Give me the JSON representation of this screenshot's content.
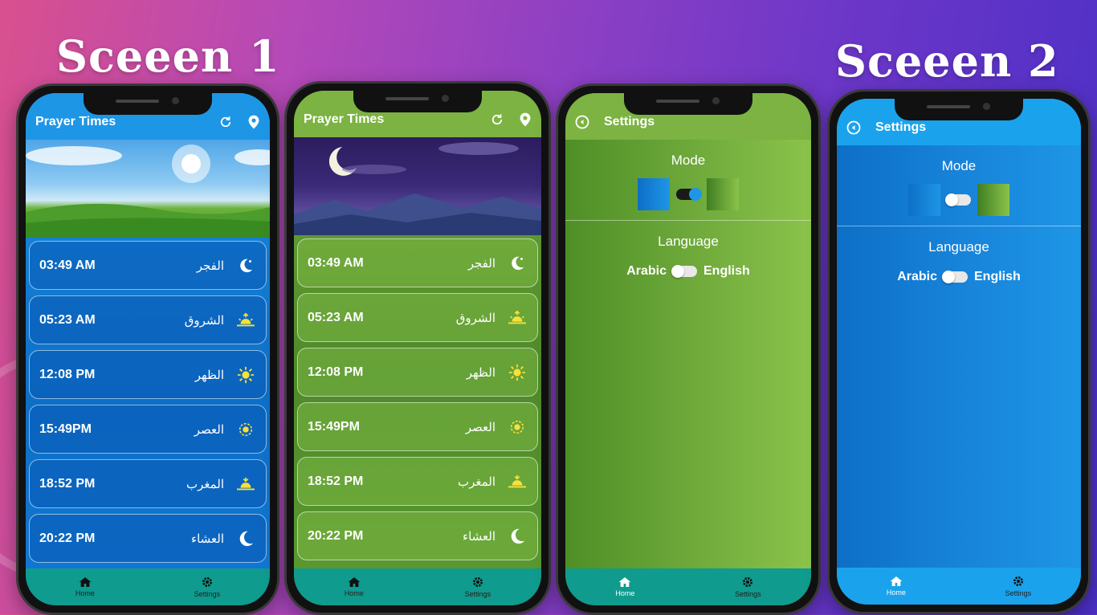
{
  "headlines": {
    "left": "Sceeen 1",
    "right": "Sceeen 2"
  },
  "home": {
    "title": "Prayer Times",
    "prayers": [
      {
        "time": "03:49 AM",
        "name": "الفجر",
        "icon": "moon-star-icon"
      },
      {
        "time": "05:23 AM",
        "name": "الشروق",
        "icon": "sunrise-icon"
      },
      {
        "time": "12:08 PM",
        "name": "الظهر",
        "icon": "sun-icon"
      },
      {
        "time": "15:49PM",
        "name": "العصر",
        "icon": "sun-ring-icon"
      },
      {
        "time": "18:52 PM",
        "name": "المغرب",
        "icon": "sunset-icon"
      },
      {
        "time": "20:22 PM",
        "name": "العشاء",
        "icon": "crescent-moon-icon"
      }
    ],
    "nav": {
      "home": "Home",
      "settings": "Settings"
    }
  },
  "settings": {
    "title": "Settings",
    "mode_label": "Mode",
    "language_label": "Language",
    "lang_left": "Arabic",
    "lang_right": "English",
    "nav": {
      "home": "Home",
      "settings": "Settings"
    }
  },
  "colors": {
    "blue_theme": "#1e88e5",
    "green_theme": "#7cb342",
    "nav_teal": "#0f9b8e",
    "nav_blue": "#1aa3ec"
  }
}
